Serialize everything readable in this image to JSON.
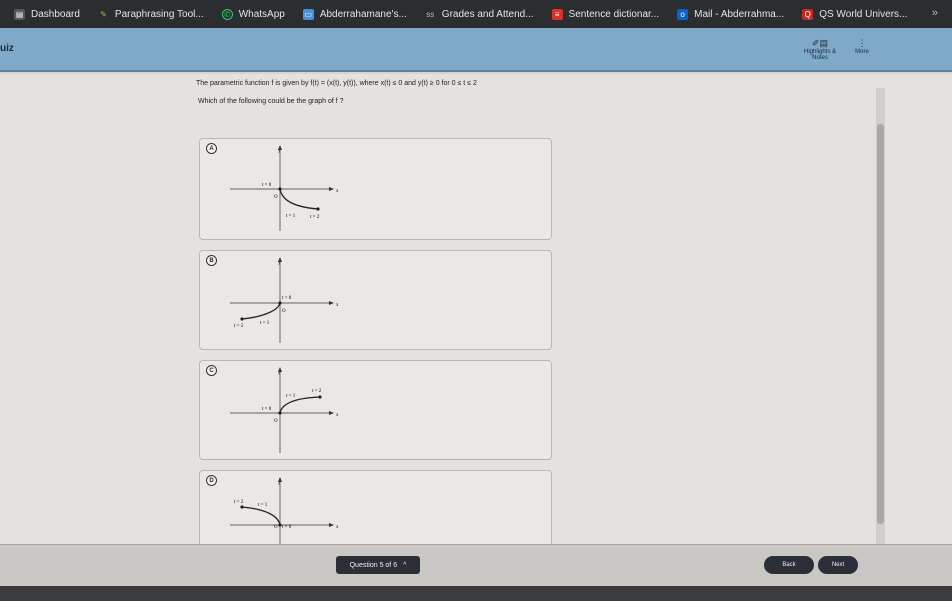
{
  "bookmarks": [
    {
      "label": "Dashboard",
      "icon": "dashboard-icon",
      "color": "#e0e0e0"
    },
    {
      "label": "Paraphrasing Tool...",
      "icon": "feather-icon",
      "color": "#8bc34a"
    },
    {
      "label": "WhatsApp",
      "icon": "whatsapp-icon",
      "color": "#25d366"
    },
    {
      "label": "Abderrahamane's...",
      "icon": "monitor-icon",
      "color": "#4a90d9"
    },
    {
      "label": "Grades and Attend...",
      "icon": "grades-icon",
      "color": "#bbbbbb"
    },
    {
      "label": "Sentence dictionar...",
      "icon": "dictionary-icon",
      "color": "#d93025"
    },
    {
      "label": "Mail - Abderrahma...",
      "icon": "outlook-icon",
      "color": "#0a64c8"
    },
    {
      "label": "QS World Univers...",
      "icon": "qs-icon",
      "color": "#c62828"
    }
  ],
  "bookmarks_more": "»",
  "header": {
    "title": "uiz",
    "highlights_label": "Highlights & Notes",
    "more_label": "More"
  },
  "question": {
    "text": "The parametric function f is given by f(t) = (x(t), y(t)), where x(t) ≤ 0 and y(t) ≥ 0 for 0 ≤ t ≤ 2",
    "prompt": "Which of the following could be the graph of f ?"
  },
  "options": [
    {
      "letter": "A",
      "labels": [
        "y",
        "x",
        "O",
        "t = 0",
        "t = 1",
        "t = 2"
      ]
    },
    {
      "letter": "B",
      "labels": [
        "y",
        "x",
        "O",
        "t = 0",
        "t = 1",
        "t = 2"
      ]
    },
    {
      "letter": "C",
      "labels": [
        "y",
        "x",
        "O",
        "t = 0",
        "t = 1",
        "t = 2"
      ]
    },
    {
      "letter": "D",
      "labels": [
        "y",
        "x",
        "O",
        "t = 0",
        "t = 1",
        "t = 2"
      ]
    }
  ],
  "footer": {
    "question_nav": "Question 5 of 6",
    "back_label": "Back",
    "next_label": "Next"
  }
}
